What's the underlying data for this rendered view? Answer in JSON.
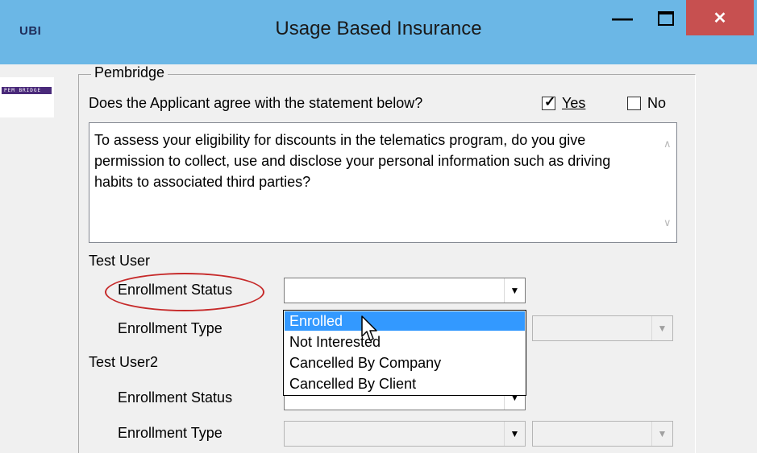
{
  "window": {
    "app_icon_text": "UBI",
    "title": "Usage Based Insurance",
    "icons": {
      "minimize": "minimize-icon",
      "maximize": "maximize-icon",
      "close": "close-icon"
    }
  },
  "logo": {
    "text": "PEM BRIDGE"
  },
  "group": {
    "label": "Pembridge",
    "question": "Does the Applicant agree with the statement below?",
    "yes_label": "Yes",
    "yes_checked": true,
    "no_label": "No",
    "no_checked": false,
    "statement": "To assess your eligibility for discounts in the telematics program, do you give permission to collect, use and disclose your personal information such as driving habits to associated third parties?"
  },
  "users": [
    {
      "name": "Test User",
      "status_label": "Enrollment Status",
      "status_value": "",
      "type_label": "Enrollment Type"
    },
    {
      "name": "Test User2",
      "status_label": "Enrollment Status",
      "status_value": "",
      "type_label": "Enrollment Type"
    }
  ],
  "dropdown": {
    "options": [
      "Enrolled",
      "Not Interested",
      "Cancelled By Company",
      "Cancelled By Client"
    ],
    "highlighted": "Enrolled"
  },
  "colors": {
    "titlebar": "#6bb7e6",
    "close_button": "#c75050",
    "selection": "#3399ff",
    "annotation": "#c62a2a"
  }
}
